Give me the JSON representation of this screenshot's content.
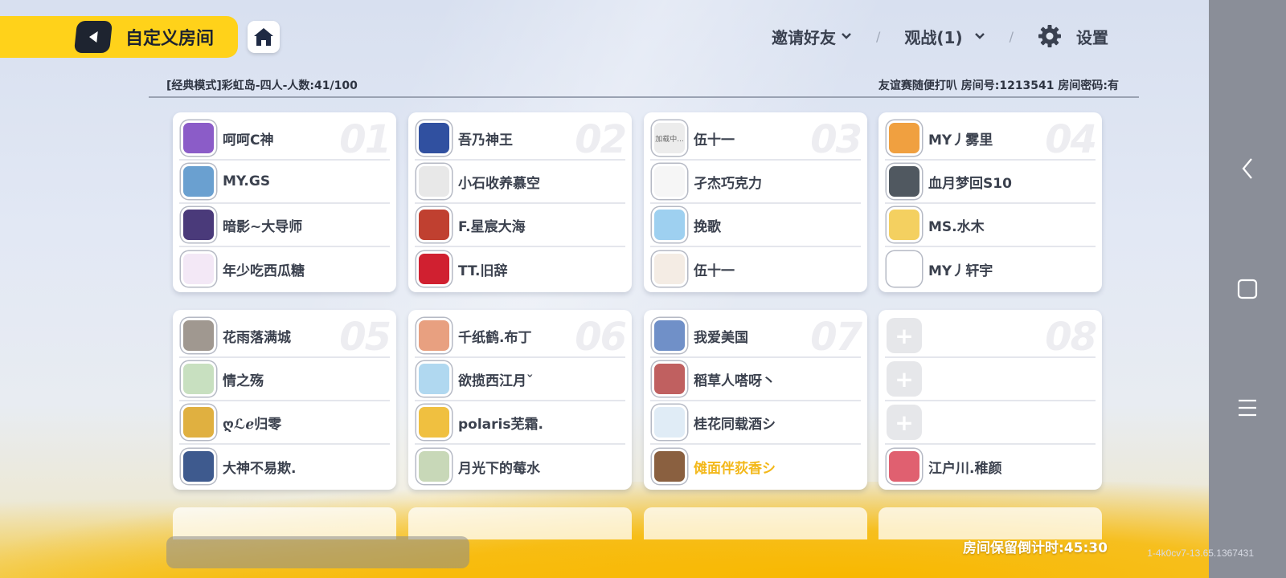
{
  "header": {
    "title": "自定义房间",
    "invite_label": "邀请好友",
    "spectate_label": "观战(1)",
    "settings_label": "设置"
  },
  "room_info": {
    "left": "[经典模式]彩虹岛-四人-人数:41/100",
    "right": "友谊赛随便打叭 房间号:1213541 房间密码:有"
  },
  "teams": [
    {
      "number": "01",
      "players": [
        {
          "name": "呵呵C神",
          "avatar": "#8b5cc8",
          "highlight": false
        },
        {
          "name": "MY.GS",
          "avatar": "#6aa0d0",
          "highlight": false
        },
        {
          "name": "暗影~大导师",
          "avatar": "#4a3a7a",
          "highlight": false
        },
        {
          "name": "年少吃西瓜糖",
          "avatar": "#f3e8f6",
          "highlight": false
        }
      ]
    },
    {
      "number": "02",
      "players": [
        {
          "name": "吾乃神王",
          "avatar": "#3050a0",
          "highlight": false
        },
        {
          "name": "小石收养慕空",
          "avatar": "#e8e8e8",
          "highlight": false
        },
        {
          "name": "F.星宸大海",
          "avatar": "#c04030",
          "highlight": false
        },
        {
          "name": "TT.旧辞",
          "avatar": "#d02030",
          "highlight": false
        }
      ]
    },
    {
      "number": "03",
      "players": [
        {
          "name": "伍十一",
          "avatar": "#ececec",
          "avatar_text": "加载中...",
          "highlight": false
        },
        {
          "name": "孑杰巧克力",
          "avatar": "#f6f6f6",
          "highlight": false
        },
        {
          "name": "挽歌",
          "avatar": "#9ed0f0",
          "highlight": false
        },
        {
          "name": "伍十一",
          "avatar": "#f4ece4",
          "highlight": false
        }
      ]
    },
    {
      "number": "04",
      "players": [
        {
          "name": "MY丿雾里",
          "avatar": "#f0a040",
          "highlight": false
        },
        {
          "name": "血月梦回S10",
          "avatar": "#505860",
          "highlight": false
        },
        {
          "name": "MS.水木",
          "avatar": "#f4d060",
          "highlight": false
        },
        {
          "name": "MY丿轩宇",
          "avatar": "#ffffff",
          "highlight": false
        }
      ]
    },
    {
      "number": "05",
      "players": [
        {
          "name": "花雨落满城",
          "avatar": "#a09890",
          "highlight": false
        },
        {
          "name": "情之殇",
          "avatar": "#c8e0c0",
          "highlight": false
        },
        {
          "name": "ღℒℯ归零",
          "avatar": "#e0b040",
          "highlight": false
        },
        {
          "name": "大神不易欺.",
          "avatar": "#3e5a8e",
          "highlight": false
        }
      ]
    },
    {
      "number": "06",
      "players": [
        {
          "name": "千纸鹤.布丁",
          "avatar": "#e8a080",
          "highlight": false
        },
        {
          "name": "欲揽西江月ˇ",
          "avatar": "#b0d8f0",
          "highlight": false
        },
        {
          "name": "polaris芜霜.",
          "avatar": "#f0c040",
          "highlight": false
        },
        {
          "name": "月光下的莓水",
          "avatar": "#c8d8b8",
          "highlight": false
        }
      ]
    },
    {
      "number": "07",
      "players": [
        {
          "name": "我爱美国",
          "avatar": "#7090c8",
          "highlight": false
        },
        {
          "name": "稻草人嗒呀丶",
          "avatar": "#c06060",
          "highlight": false
        },
        {
          "name": "桂花同载酒シ",
          "avatar": "#e0ecf6",
          "highlight": false
        },
        {
          "name": "傩面伴荻香シ",
          "avatar": "#8a6040",
          "highlight": true
        }
      ]
    },
    {
      "number": "08",
      "players": [
        {
          "name": "",
          "avatar": "",
          "highlight": false,
          "empty": true
        },
        {
          "name": "",
          "avatar": "",
          "highlight": false,
          "empty": true
        },
        {
          "name": "",
          "avatar": "",
          "highlight": false,
          "empty": true
        },
        {
          "name": "江户川.稚颜",
          "avatar": "#e06070",
          "highlight": false
        }
      ]
    }
  ],
  "empty_slot_symbol": "+",
  "footer": {
    "timer": "房间保留倒计时:45:30",
    "build": "1-4k0cv7-13.65.1367431"
  },
  "colors": {
    "accent": "#ffd21a",
    "highlight_name": "#f3b81a",
    "dark": "#1e2430"
  }
}
